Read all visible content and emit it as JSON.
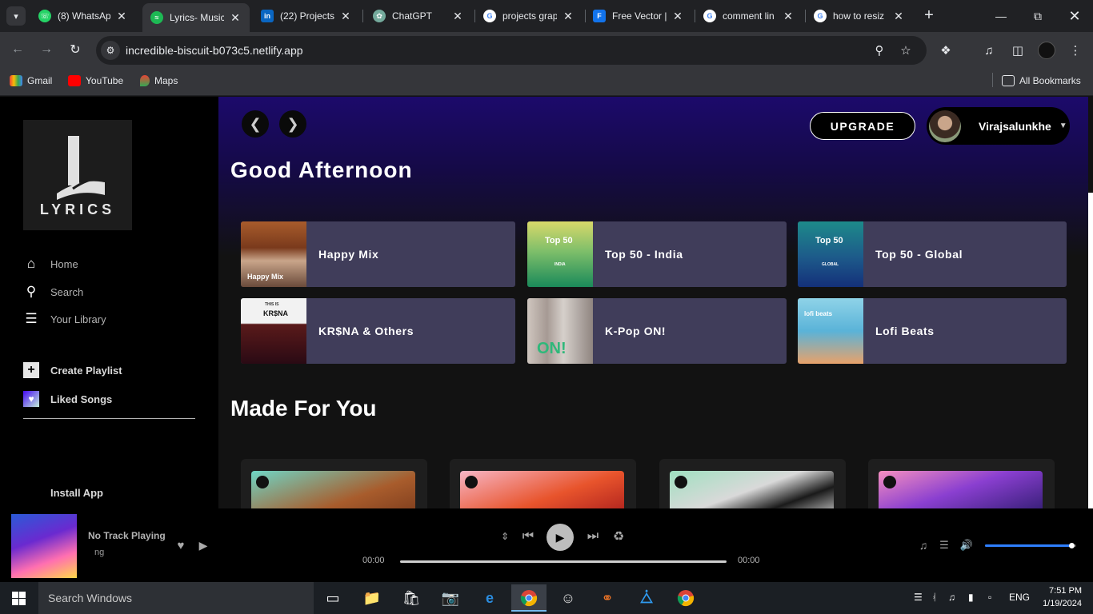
{
  "browser": {
    "tabs": [
      {
        "title": "(8) WhatsApp",
        "icon": "whatsapp-icon",
        "color": "#25d366"
      },
      {
        "title": "Lyrics- Music",
        "icon": "spotify-icon",
        "color": "#1db954",
        "active": true
      },
      {
        "title": "(22) Projects",
        "icon": "linkedin-icon",
        "color": "#0a66c2"
      },
      {
        "title": "ChatGPT",
        "icon": "chatgpt-icon",
        "color": "#74aa9c"
      },
      {
        "title": "projects grap",
        "icon": "google-icon",
        "color": "#4285f4"
      },
      {
        "title": "Free Vector |",
        "icon": "freepik-icon",
        "color": "#1273eb"
      },
      {
        "title": "comment lin",
        "icon": "google-icon",
        "color": "#4285f4"
      },
      {
        "title": "how to resiz",
        "icon": "google-icon",
        "color": "#4285f4"
      }
    ],
    "url": "incredible-biscuit-b073c5.netlify.app",
    "bookmarks": [
      {
        "label": "Gmail",
        "icon": "gmail-icon"
      },
      {
        "label": "YouTube",
        "icon": "youtube-icon"
      },
      {
        "label": "Maps",
        "icon": "maps-icon"
      }
    ],
    "all_bookmarks": "All Bookmarks"
  },
  "sidebar": {
    "logo_text": "LYRICS",
    "nav": [
      {
        "label": "Home",
        "icon": "home-icon"
      },
      {
        "label": "Search",
        "icon": "search-icon"
      },
      {
        "label": "Your Library",
        "icon": "library-icon"
      }
    ],
    "create_playlist": "Create Playlist",
    "liked_songs": "Liked Songs",
    "install_app": "Install App"
  },
  "header": {
    "upgrade": "UPGRADE",
    "username": "Virajsalunkhe"
  },
  "main": {
    "greeting": "Good Afternoon",
    "shortcuts": [
      {
        "title": "Happy Mix",
        "art_text": "Happy Mix"
      },
      {
        "title": "Top 50 - India",
        "art_text": "Top 50",
        "art_sub": "INDIA"
      },
      {
        "title": "Top 50 - Global",
        "art_text": "Top 50",
        "art_sub": "GLOBAL"
      },
      {
        "title": "KR$NA & Others",
        "art_text": "KR$NA",
        "art_sub": "THIS IS"
      },
      {
        "title": "K-Pop ON!",
        "art_text": "ON!"
      },
      {
        "title": "Lofi Beats",
        "art_text": "lofi beats"
      }
    ],
    "made_for_you_title": "Made For You"
  },
  "player": {
    "title": "No Track Playing",
    "subtitle": "ng",
    "time_elapsed": "00:00",
    "time_total": "00:00",
    "volume": 0.96
  },
  "taskbar": {
    "search_placeholder": "Search Windows",
    "language": "ENG",
    "time": "7:51 PM",
    "date": "1/19/2024"
  }
}
